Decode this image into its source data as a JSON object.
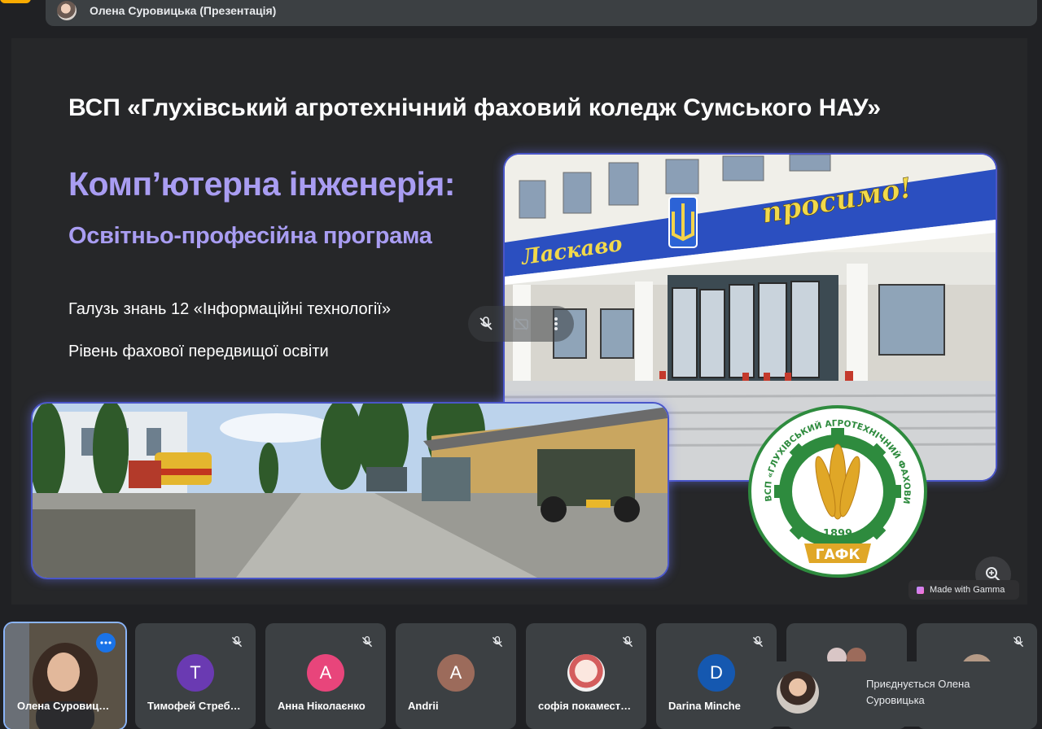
{
  "top_bar": {
    "presenter_title": "Олена Суровицька (Презентація)"
  },
  "slide": {
    "title": "ВСП «Глухівський агротехнічний фаховий коледж Сумського НАУ»",
    "program_title": "Комп’ютерна інженерія:",
    "program_subtitle": "Освітньо-професійна програма",
    "field_line": "Галузь знань 12 «Інформаційні технології»",
    "level_line": "Рівень фахової передвищої освіти",
    "building_sign_left": "Ласкаво",
    "building_sign_right": "просимо!",
    "logo": {
      "ring_text": "ВСП «ГЛУХІВСЬКИЙ АГРОТЕХНІЧНИЙ ФАХОВИЙ КОЛЕДЖ СНАУ»",
      "year": "1899",
      "abbr": "ГАФК"
    },
    "made_with": "Made with Gamma"
  },
  "participants": [
    {
      "name": "Олена Суровиц…",
      "initial": "",
      "color": "",
      "active": true
    },
    {
      "name": "Тимофей Стреб…",
      "initial": "T",
      "color": "#6a3ab2"
    },
    {
      "name": "Анна Ніколаєнко",
      "initial": "A",
      "color": "#e8457b"
    },
    {
      "name": "Andrii",
      "initial": "A",
      "color": "#9c6b5b"
    },
    {
      "name": "софія покамест…",
      "initial": "",
      "color": ""
    },
    {
      "name": "Darina Minche",
      "initial": "D",
      "color": "#1558b0"
    },
    {
      "name": "",
      "initial": "",
      "color": ""
    },
    {
      "name": "",
      "initial": "",
      "color": ""
    }
  ],
  "join_notice": {
    "text": "Приєднується Олена Суровицька"
  },
  "colors": {
    "accent_blue": "#1a73e8",
    "slide_purple": "#a99df2",
    "background": "#202124"
  }
}
